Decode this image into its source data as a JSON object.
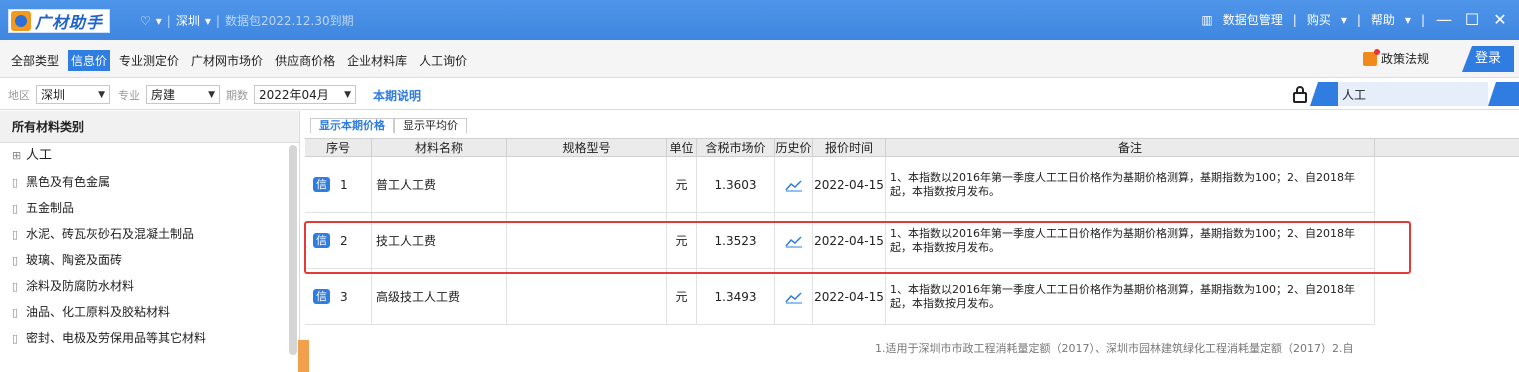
{
  "titlebar": {
    "app_name": "广材助手",
    "region": "深圳",
    "package_expiry": "数据包2022.12.30到期",
    "data_pkg": "数据包管理",
    "buy": "购买",
    "help": "帮助"
  },
  "categories": {
    "items": [
      "全部类型",
      "信息价",
      "专业测定价",
      "广材网市场价",
      "供应商价格",
      "企业材料库",
      "人工询价"
    ],
    "policy": "政策法规",
    "login": "登录"
  },
  "filters": {
    "region_label": "地区",
    "region_value": "深圳",
    "major_label": "专业",
    "major_value": "房建",
    "period_label": "期数",
    "period_value": "2022年04月",
    "desc_link": "本期说明",
    "search_value": "人工"
  },
  "sidebar": {
    "header": "所有材料类别",
    "items": [
      "人工",
      "黑色及有色金属",
      "五金制品",
      "水泥、砖瓦灰砂石及混凝土制品",
      "玻璃、陶瓷及面砖",
      "涂料及防腐防水材料",
      "油品、化工原料及胶粘材料",
      "密封、电极及劳保用品等其它材料"
    ]
  },
  "tabs": [
    "显示本期价格",
    "显示平均价"
  ],
  "table": {
    "headers": [
      "序号",
      "材料名称",
      "规格型号",
      "单位",
      "含税市场价",
      "历史价",
      "报价时间",
      "备注"
    ],
    "badge": "信",
    "rows": [
      {
        "no": "1",
        "name": "普工人工费",
        "spec": "",
        "unit": "元",
        "price": "1.3603",
        "date": "2022-04-15",
        "note": "1、本指数以2016年第一季度人工工日价格作为基期价格测算，基期指数为100；2、自2018年起，本指数按月发布。"
      },
      {
        "no": "2",
        "name": "技工人工费",
        "spec": "",
        "unit": "元",
        "price": "1.3523",
        "date": "2022-04-15",
        "note": "1、本指数以2016年第一季度人工工日价格作为基期价格测算，基期指数为100；2、自2018年起，本指数按月发布。"
      },
      {
        "no": "3",
        "name": "高级技工人工费",
        "spec": "",
        "unit": "元",
        "price": "1.3493",
        "date": "2022-04-15",
        "note": "1、本指数以2016年第一季度人工工日价格作为基期价格测算，基期指数为100；2、自2018年起，本指数按月发布。"
      }
    ],
    "partial_note": "1.适用于深圳市市政工程消耗量定额（2017）、深圳市园林建筑绿化工程消耗量定额（2017）2.自"
  }
}
